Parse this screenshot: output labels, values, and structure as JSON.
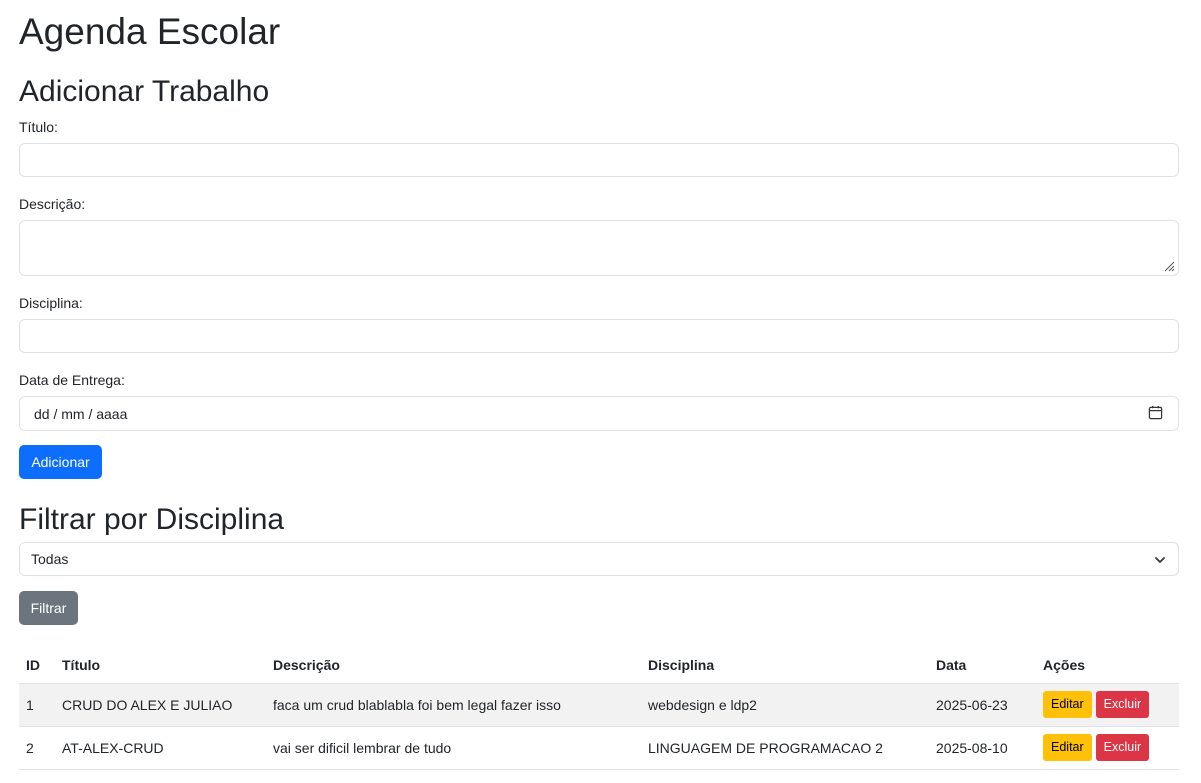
{
  "page_title": "Agenda Escolar",
  "add_section": {
    "heading": "Adicionar Trabalho",
    "title_label": "Título:",
    "title_value": "",
    "description_label": "Descrição:",
    "description_value": "",
    "discipline_label": "Disciplina:",
    "discipline_value": "",
    "due_date_label": "Data de Entrega:",
    "due_date_placeholder": "dd / mm / aaaa",
    "add_button": "Adicionar"
  },
  "filter_section": {
    "heading": "Filtrar por Disciplina",
    "selected": "Todas",
    "filter_button": "Filtrar"
  },
  "table": {
    "headers": [
      "ID",
      "Título",
      "Descrição",
      "Disciplina",
      "Data",
      "Ações"
    ],
    "rows": [
      {
        "id": "1",
        "title": "CRUD DO ALEX E JULIAO",
        "description": "faca um crud blablabla foi bem legal fazer isso",
        "discipline": "webdesign e ldp2",
        "date": "2025-06-23"
      },
      {
        "id": "2",
        "title": "AT-ALEX-CRUD",
        "description": "vai ser dificil lembrar de tudo",
        "discipline": "LINGUAGEM DE PROGRAMACAO 2",
        "date": "2025-08-10"
      }
    ],
    "edit_label": "Editar",
    "delete_label": "Excluir"
  },
  "icons": {
    "calendar": "calendar-icon",
    "chevron": "chevron-down-icon",
    "resize": "resize-handle-icon"
  },
  "colors": {
    "primary": "#0d6efd",
    "secondary": "#6c757d",
    "warning": "#ffc107",
    "danger": "#dc3545"
  }
}
